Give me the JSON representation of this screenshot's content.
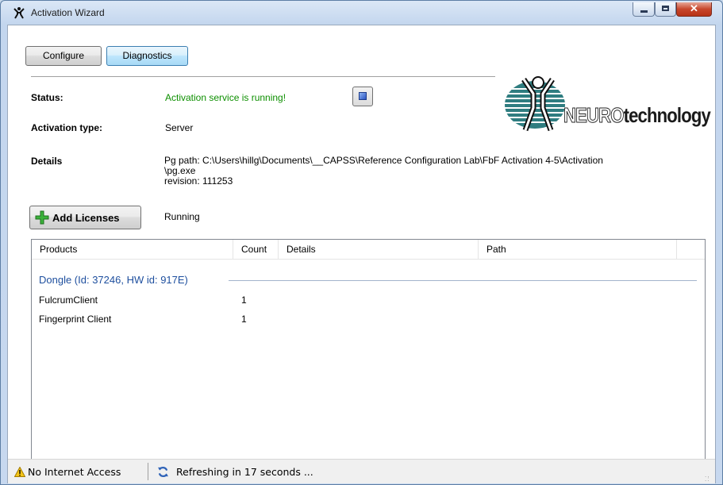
{
  "window": {
    "title": "Activation Wizard"
  },
  "toolbar": {
    "configure_label": "Configure",
    "diagnostics_label": "Diagnostics"
  },
  "status": {
    "label": "Status:",
    "value": "Activation service is running!",
    "value_color": "#0d8f00"
  },
  "activation_type": {
    "label": "Activation type:",
    "value": "Server"
  },
  "details": {
    "label": "Details",
    "line1": "Pg path: C:\\Users\\hillg\\Documents\\__CAPSS\\Reference Configuration Lab\\FbF Activation 4-5\\Activation",
    "line2": "\\pg.exe",
    "line3": "revision: 111253"
  },
  "logo": {
    "text_part1": "NEURO",
    "text_part2": "technology"
  },
  "licenses": {
    "add_button_label": "Add Licenses",
    "state": "Running"
  },
  "table": {
    "columns": [
      "Products",
      "Count",
      "Details",
      "Path"
    ],
    "group": "Dongle (Id: 37246, HW id: 917E)",
    "rows": [
      {
        "product": "FulcrumClient",
        "count": "1",
        "details": "",
        "path": ""
      },
      {
        "product": "Fingerprint Client",
        "count": "1",
        "details": "",
        "path": ""
      }
    ]
  },
  "statusbar": {
    "internet": "No Internet Access",
    "refresh": "Refreshing in 17 seconds ..."
  },
  "icons": {
    "app": "neurotechnology-figure-icon",
    "stop": "stop-icon",
    "add": "green-plus-icon",
    "warning": "warning-triangle-icon",
    "refresh": "refresh-icon"
  }
}
